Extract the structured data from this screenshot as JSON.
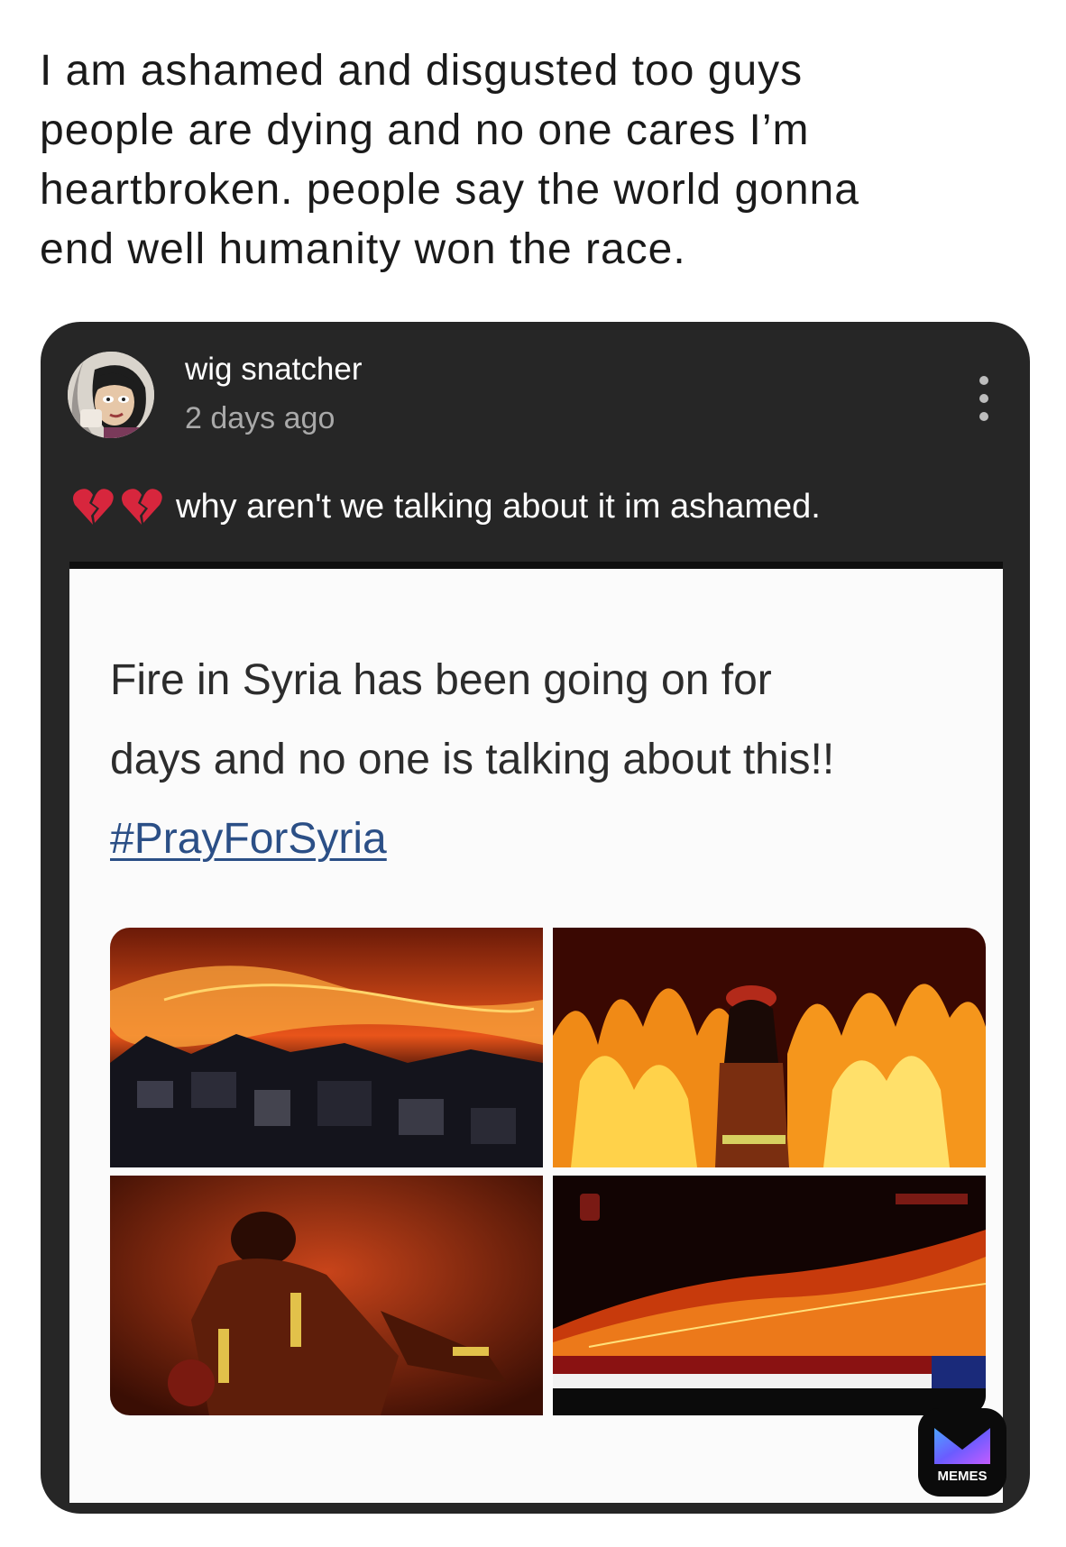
{
  "caption": {
    "line1": "I am ashamed and disgusted too guys",
    "line2": "people are dying and no one cares I’m",
    "line3": "heartbroken. people say the world gonna",
    "line4": "end well humanity won the race."
  },
  "post": {
    "username": "wig snatcher",
    "timestamp": "2 days ago",
    "emoji": "💔💔",
    "text": "why aren't we talking about it im ashamed.",
    "more_icon": "more-vertical-icon"
  },
  "embed": {
    "line1": "Fire in Syria has been going on for",
    "line2": "days and no one is talking about this!!",
    "hashtag": "#PrayForSyria",
    "photos": [
      "wildfire-hillside-night-photo",
      "firefighter-flames-photo",
      "firefighter-resting-photo",
      "news-broadcast-fire-photo"
    ]
  },
  "watermark": {
    "label": "MEMES"
  },
  "colors": {
    "card_bg": "#262626",
    "hashtag": "#2b4f86",
    "fire_orange": "#f26a13",
    "heart_red": "#d7263d"
  }
}
